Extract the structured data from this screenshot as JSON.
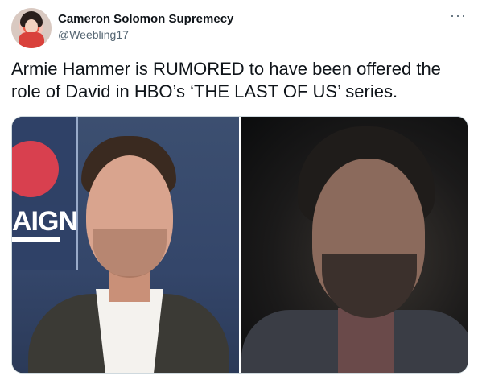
{
  "tweet": {
    "display_name": "Cameron Solomon Supremecy",
    "handle": "@Weebling17",
    "text": "Armie Hammer is RUMORED to have been offered the role of David in HBO’s ‘THE LAST OF US’ series.",
    "more_icon": "···"
  },
  "media": {
    "left_backdrop_text": "AIGN",
    "backdrop_circle_color": "#d8404f"
  }
}
